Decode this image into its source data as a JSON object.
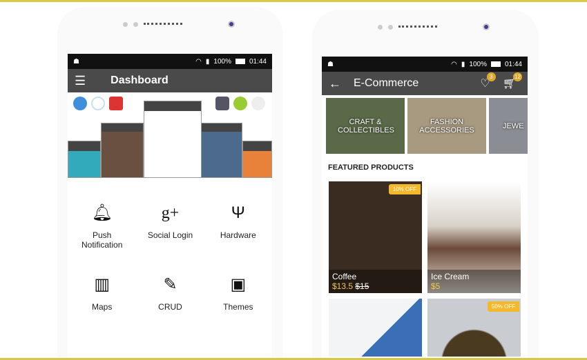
{
  "status": {
    "battery": "100%",
    "time": "01:44"
  },
  "dashboard": {
    "title": "Dashboard",
    "items": [
      {
        "label": "Push Notification",
        "icon": "bell-icon"
      },
      {
        "label": "Social Login",
        "icon": "google-plus-icon"
      },
      {
        "label": "Hardware",
        "icon": "usb-icon"
      },
      {
        "label": "Maps",
        "icon": "map-icon"
      },
      {
        "label": "CRUD",
        "icon": "pencil-icon"
      },
      {
        "label": "Themes",
        "icon": "easel-icon"
      }
    ]
  },
  "ecommerce": {
    "title": "E-Commerce",
    "wishlist_count": "3",
    "cart_count": "12",
    "categories": [
      {
        "label": "CRAFT & COLLECTIBLES",
        "color": "#5a6a48"
      },
      {
        "label": "FASHION ACCESSORIES",
        "color": "#a89a80"
      },
      {
        "label": "JEWE",
        "color": "#8a8e94"
      }
    ],
    "featured_title": "FEATURED PRODUCTS",
    "products": [
      {
        "name": "Coffee",
        "price": "$13.5",
        "old_price": "$15",
        "discount": "10% OFF",
        "color": "#3a2c20"
      },
      {
        "name": "Ice Cream",
        "price": "$5",
        "old_price": "",
        "discount": "",
        "color": "#d8d2c8"
      },
      {
        "name": "",
        "price": "",
        "old_price": "",
        "discount": "",
        "color": "#eef0f2"
      },
      {
        "name": "",
        "price": "",
        "old_price": "",
        "discount": "50% OFF",
        "color": "#c9ccd0"
      }
    ]
  },
  "colors": {
    "toolbar": "#4a4a4a",
    "accent": "#f5b82a",
    "background": "#2f7ce8"
  }
}
